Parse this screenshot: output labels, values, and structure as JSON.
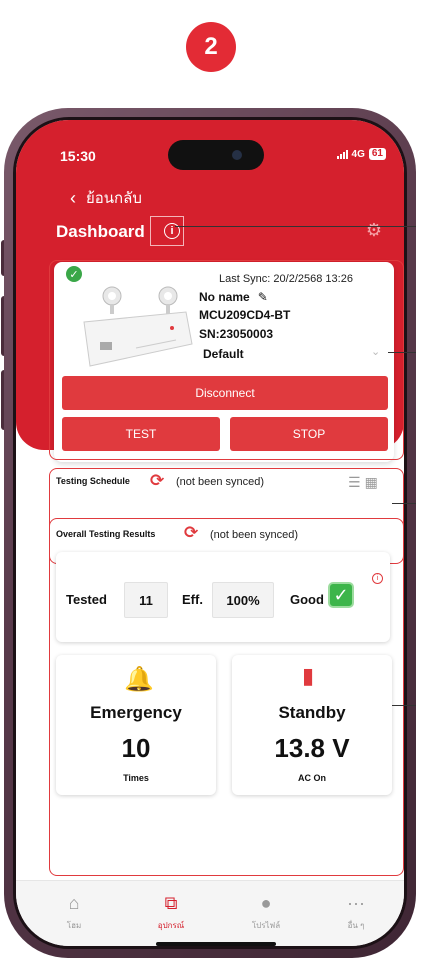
{
  "step_number": "2",
  "status_bar": {
    "time": "15:30",
    "network": "4G",
    "battery": "61"
  },
  "header": {
    "back_label": "ย้อนกลับ",
    "title": "Dashboard"
  },
  "device": {
    "last_sync": "Last Sync: 20/2/2568 13:26",
    "name": "No name",
    "model": "MCU209CD4-BT",
    "serial": "SN:23050003",
    "profile": "Default"
  },
  "buttons": {
    "disconnect": "Disconnect",
    "test": "TEST",
    "stop": "STOP"
  },
  "testing_schedule": {
    "title": "Testing Schedule",
    "status": "(not been synced)"
  },
  "overall_results": {
    "title": "Overall Testing Results",
    "status": "(not been synced)",
    "tested_label": "Tested",
    "tested_value": "11",
    "eff_label": "Eff.",
    "eff_value": "100%",
    "good_label": "Good"
  },
  "tiles": {
    "emergency": {
      "label": "Emergency",
      "value": "10",
      "sub": "Times"
    },
    "standby": {
      "label": "Standby",
      "value": "13.8 V",
      "sub": "AC On"
    }
  },
  "nav": [
    {
      "label": "โฮม",
      "icon": "home-icon"
    },
    {
      "label": "อุปกรณ์",
      "icon": "device-icon"
    },
    {
      "label": "โปรไฟล์",
      "icon": "profile-icon"
    },
    {
      "label": "อื่น ๆ",
      "icon": "more-icon"
    }
  ],
  "colors": {
    "brand_red": "#d5202d",
    "button_red": "#e03a3e",
    "good_green": "#3db54a"
  }
}
